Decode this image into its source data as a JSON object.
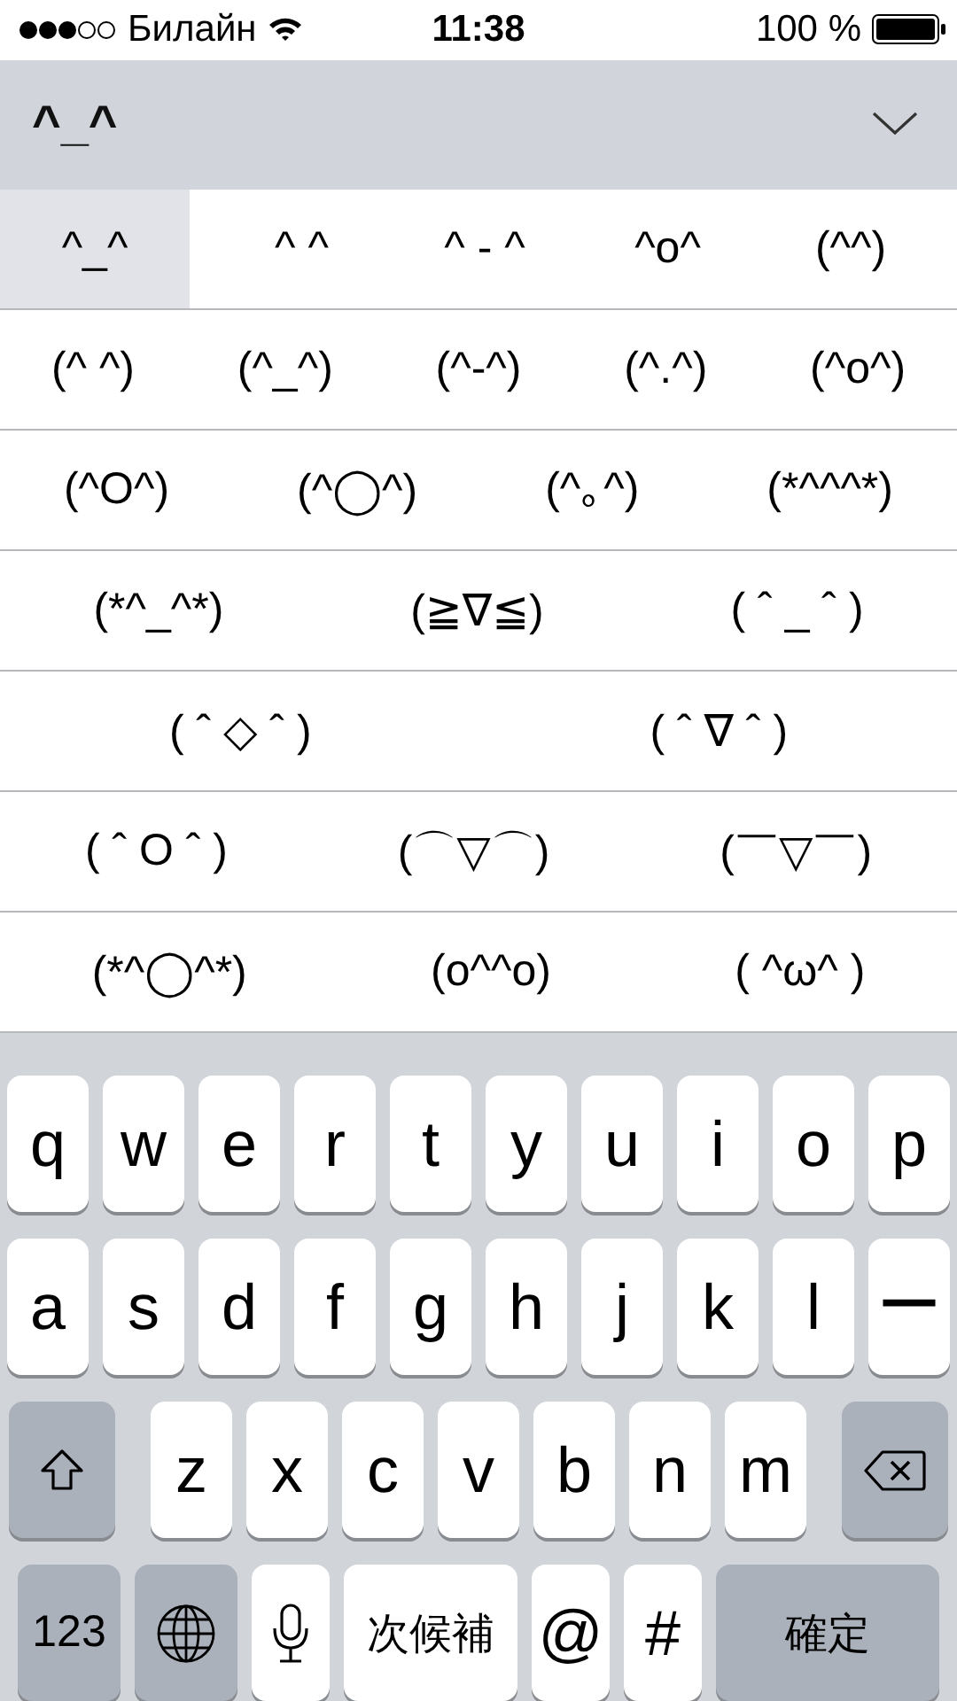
{
  "status_bar": {
    "carrier": "Билайн",
    "time": "11:38",
    "battery": "100 %"
  },
  "input_bar": {
    "text": "^_^"
  },
  "candidates": [
    [
      {
        "text": "^_^",
        "selected": true
      },
      {
        "text": "^ ^",
        "selected": false
      },
      {
        "text": "^ - ^",
        "selected": false
      },
      {
        "text": "^o^",
        "selected": false
      },
      {
        "text": "(^^)",
        "selected": false
      }
    ],
    [
      {
        "text": "(^ ^)",
        "selected": false
      },
      {
        "text": "(^_^)",
        "selected": false
      },
      {
        "text": "(^-^)",
        "selected": false
      },
      {
        "text": "(^.^)",
        "selected": false
      },
      {
        "text": "(^o^)",
        "selected": false
      }
    ],
    [
      {
        "text": "(^O^)",
        "selected": false
      },
      {
        "text": "(^◯^)",
        "selected": false
      },
      {
        "text": "(^｡^)",
        "selected": false
      },
      {
        "text": "(*^^^*)",
        "selected": false
      }
    ],
    [
      {
        "text": "(*^_^*)",
        "selected": false
      },
      {
        "text": "(≧∇≦)",
        "selected": false
      },
      {
        "text": "( ˆ _ ˆ )",
        "selected": false
      }
    ],
    [
      {
        "text": "( ˆ ◇ ˆ )",
        "selected": false
      },
      {
        "text": "( ˆ ∇ ˆ )",
        "selected": false
      }
    ],
    [
      {
        "text": "( ˆ O ˆ )",
        "selected": false
      },
      {
        "text": "(⌒▽⌒)",
        "selected": false
      },
      {
        "text": "(￣▽￣)",
        "selected": false
      }
    ],
    [
      {
        "text": "(*^◯^*)",
        "selected": false
      },
      {
        "text": "(o^^o)",
        "selected": false
      },
      {
        "text": "( ^ω^ )",
        "selected": false
      }
    ]
  ],
  "keyboard": [
    [
      {
        "kind": "letter",
        "label": "q"
      },
      {
        "kind": "letter",
        "label": "w"
      },
      {
        "kind": "letter",
        "label": "e"
      },
      {
        "kind": "letter",
        "label": "r"
      },
      {
        "kind": "letter",
        "label": "t"
      },
      {
        "kind": "letter",
        "label": "y"
      },
      {
        "kind": "letter",
        "label": "u"
      },
      {
        "kind": "letter",
        "label": "i"
      },
      {
        "kind": "letter",
        "label": "o"
      },
      {
        "kind": "letter",
        "label": "p"
      }
    ],
    [
      {
        "kind": "letter",
        "label": "a"
      },
      {
        "kind": "letter",
        "label": "s"
      },
      {
        "kind": "letter",
        "label": "d"
      },
      {
        "kind": "letter",
        "label": "f"
      },
      {
        "kind": "letter",
        "label": "g"
      },
      {
        "kind": "letter",
        "label": "h"
      },
      {
        "kind": "letter",
        "label": "j"
      },
      {
        "kind": "letter",
        "label": "k"
      },
      {
        "kind": "letter",
        "label": "l"
      },
      {
        "kind": "letter",
        "label": "ー"
      }
    ],
    [
      {
        "kind": "shift"
      },
      {
        "kind": "letter",
        "label": "z"
      },
      {
        "kind": "letter",
        "label": "x"
      },
      {
        "kind": "letter",
        "label": "c"
      },
      {
        "kind": "letter",
        "label": "v"
      },
      {
        "kind": "letter",
        "label": "b"
      },
      {
        "kind": "letter",
        "label": "n"
      },
      {
        "kind": "letter",
        "label": "m"
      },
      {
        "kind": "delete"
      }
    ],
    [
      {
        "kind": "special",
        "label": "123"
      },
      {
        "kind": "globe"
      },
      {
        "kind": "mic"
      },
      {
        "kind": "wide",
        "label": "次候補"
      },
      {
        "kind": "letter",
        "label": "@"
      },
      {
        "kind": "letter",
        "label": "#"
      },
      {
        "kind": "return",
        "label": "確定"
      }
    ]
  ]
}
